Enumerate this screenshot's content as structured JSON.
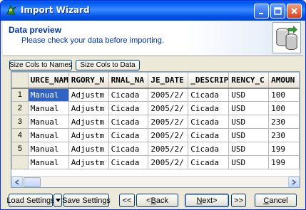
{
  "window": {
    "title": "Import Wizard"
  },
  "header": {
    "title": "Data preview",
    "subtitle": "Please check your data before importing."
  },
  "toolbar": {
    "size_to_names": "Size Cols to Names",
    "size_to_data": "Size Cols to Data"
  },
  "grid": {
    "columns": [
      "URCE_NAM",
      "RGORY_N",
      "RNAL_NA",
      "JE_DATE",
      "_DESCRIP",
      "RENCY_C",
      "AMOUN"
    ],
    "rows": [
      {
        "num": "1",
        "cells": [
          "Manual",
          "Adjustm",
          "Cicada",
          "2005/2/",
          "Cicada",
          "USD",
          "100"
        ]
      },
      {
        "num": "2",
        "cells": [
          "Manual",
          "Adjustm",
          "Cicada",
          "2005/2/",
          "Cicada",
          "USD",
          "100"
        ]
      },
      {
        "num": "3",
        "cells": [
          "Manual",
          "Adjustm",
          "Cicada",
          "2005/2/",
          "Cicada",
          "USD",
          "230"
        ]
      },
      {
        "num": "4",
        "cells": [
          "Manual",
          "Adjustm",
          "Cicada",
          "2005/2/",
          "Cicada",
          "USD",
          "230"
        ]
      },
      {
        "num": "5",
        "cells": [
          "Manual",
          "Adjustm",
          "Cicada",
          "2005/2/",
          "Cicada",
          "USD",
          "199"
        ]
      },
      {
        "num": "",
        "cells": [
          "Manual",
          "Adjustm",
          "Cicada",
          "2005/2/",
          "Cicada",
          "USD",
          "199"
        ]
      }
    ]
  },
  "footer": {
    "load_settings": "Load Settings",
    "save_settings": "Save Settings",
    "first": "<<",
    "back_prefix": "< ",
    "back_hot": "B",
    "back_rest": "ack",
    "next_hot": "N",
    "next_rest": "ext",
    "next_suffix": " >",
    "last": ">>",
    "cancel_hot": "C",
    "cancel_rest": "ancel"
  },
  "colors": {
    "title_bar": "#0058ee",
    "selection": "#3163c5",
    "header_text": "#003399"
  }
}
